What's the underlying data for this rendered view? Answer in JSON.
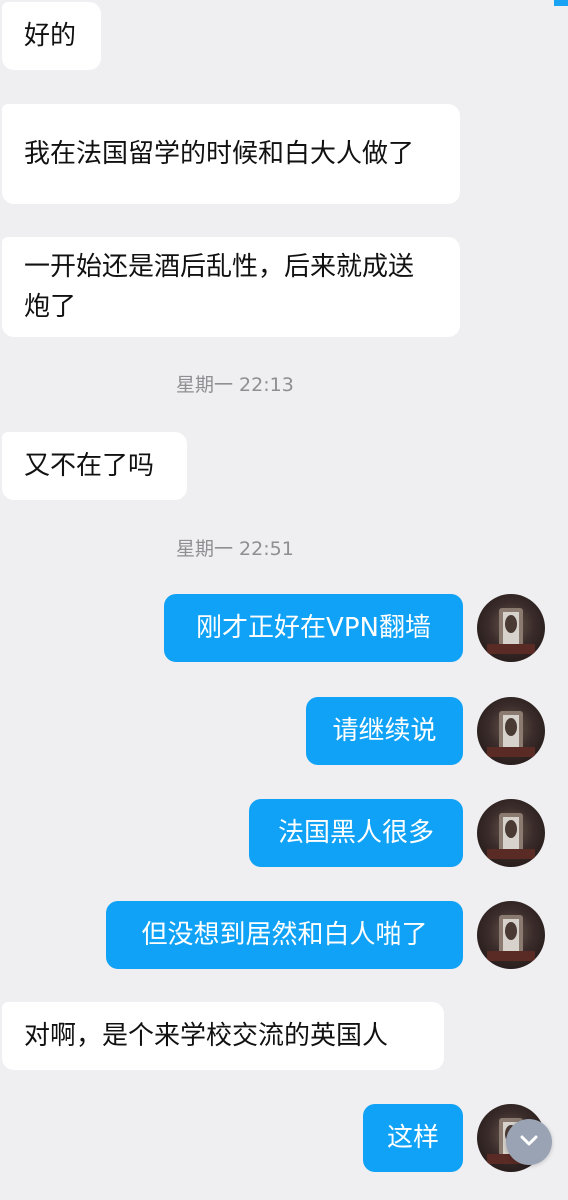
{
  "messages": [
    {
      "direction": "in",
      "text": "好的"
    },
    {
      "direction": "in",
      "text": "我在法国留学的时候和白大人做了"
    },
    {
      "direction": "in",
      "text": "一开始还是酒后乱性，后来就成送炮了"
    },
    {
      "direction": "in",
      "text": "又不在了吗"
    },
    {
      "direction": "out",
      "text": "刚才正好在VPN翻墙"
    },
    {
      "direction": "out",
      "text": "请继续说"
    },
    {
      "direction": "out",
      "text": "法国黑人很多"
    },
    {
      "direction": "out",
      "text": "但没想到居然和白人啪了"
    },
    {
      "direction": "in",
      "text": "对啊，是个来学校交流的英国人"
    },
    {
      "direction": "out",
      "text": "这样"
    }
  ],
  "timestamps": [
    "星期一 22:13",
    "星期一 22:51"
  ],
  "colors": {
    "background": "#efeff1",
    "incoming_bubble": "#ffffff",
    "outgoing_bubble": "#0fa2f6",
    "timestamp_text": "#8e8e93",
    "scroll_button": "#9aa3b3"
  },
  "icons": {
    "scroll_button": "chevron-down-icon",
    "avatar": "user-avatar"
  }
}
